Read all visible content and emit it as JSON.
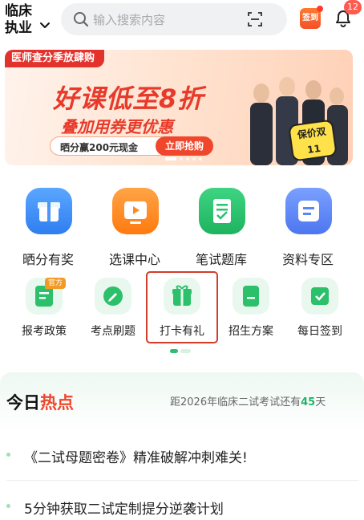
{
  "header": {
    "location_line1": "临床",
    "location_line2": "执业",
    "search_placeholder": "输入搜索内容",
    "sign_label": "签到",
    "notification_count": "12"
  },
  "banner": {
    "tag": "医师查分季放肆购",
    "title": "好课低至8折",
    "subtitle": "叠加用券更优惠",
    "pill_left": "晒分赢200元现金",
    "pill_right": "立即抢购",
    "stamp": "保价双11"
  },
  "main_grid": [
    {
      "label": "晒分有奖",
      "color": "#3f8ff5"
    },
    {
      "label": "选课中心",
      "color": "#ff8a1f"
    },
    {
      "label": "笔试题库",
      "color": "#25c46e"
    },
    {
      "label": "资料专区",
      "color": "#5b86f5"
    }
  ],
  "sub_grid": [
    {
      "label": "报考政策",
      "badge": "官方"
    },
    {
      "label": "考点刷题",
      "badge": ""
    },
    {
      "label": "打卡有礼",
      "badge": ""
    },
    {
      "label": "招生方案",
      "badge": ""
    },
    {
      "label": "每日签到",
      "badge": ""
    }
  ],
  "hot": {
    "title_prefix": "今日",
    "title_emphasis": "热点",
    "countdown_prefix": "距2026年临床二试考试还有",
    "countdown_days": "45",
    "countdown_unit": "天",
    "items": [
      "《二试母题密卷》精准破解冲刺难关!",
      "5分钟获取二试定制提分逆袭计划"
    ]
  }
}
